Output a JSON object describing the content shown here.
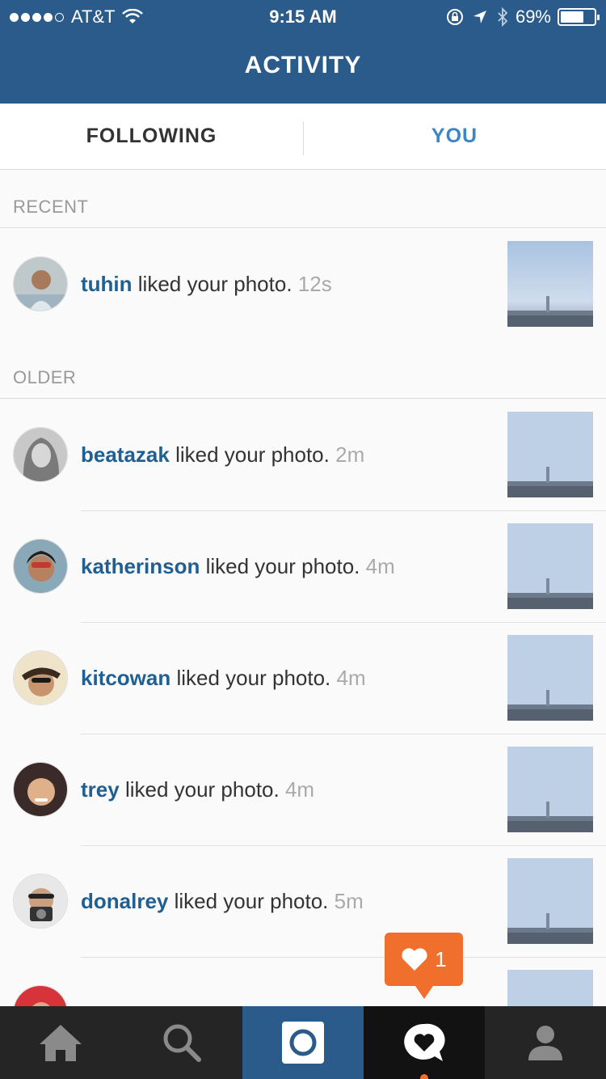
{
  "status_bar": {
    "carrier": "AT&T",
    "time": "9:15 AM",
    "battery_percent": "69%",
    "battery_level": 0.69,
    "icons": [
      "signal-dots-icon",
      "wifi-icon",
      "rotation-lock-icon",
      "location-arrow-icon",
      "bluetooth-icon",
      "battery-icon"
    ]
  },
  "header": {
    "title": "ACTIVITY"
  },
  "tabs": [
    {
      "label": "FOLLOWING",
      "active": false
    },
    {
      "label": "YOU",
      "active": true
    }
  ],
  "sections": {
    "recent_label": "RECENT",
    "older_label": "OLDER"
  },
  "activity": {
    "recent": [
      {
        "user": "tuhin",
        "action": "liked your photo.",
        "time": "12s"
      }
    ],
    "older": [
      {
        "user": "beatazak",
        "action": "liked your photo.",
        "time": "2m"
      },
      {
        "user": "katherinson",
        "action": "liked your photo.",
        "time": "4m"
      },
      {
        "user": "kitcowan",
        "action": "liked your photo.",
        "time": "4m"
      },
      {
        "user": "trey",
        "action": "liked your photo.",
        "time": "4m"
      },
      {
        "user": "donalrey",
        "action": "liked your photo.",
        "time": "5m"
      }
    ]
  },
  "notification": {
    "count": "1",
    "icon": "heart-icon"
  },
  "tab_bar": {
    "items": [
      "home-icon",
      "search-icon",
      "camera-icon",
      "activity-heart-icon",
      "profile-icon"
    ],
    "accent": "#f16f2c"
  },
  "colors": {
    "header_bg": "#2b5b8a",
    "username": "#1f5f92",
    "active_tab": "#3d86c6",
    "notification": "#f16f2c"
  }
}
